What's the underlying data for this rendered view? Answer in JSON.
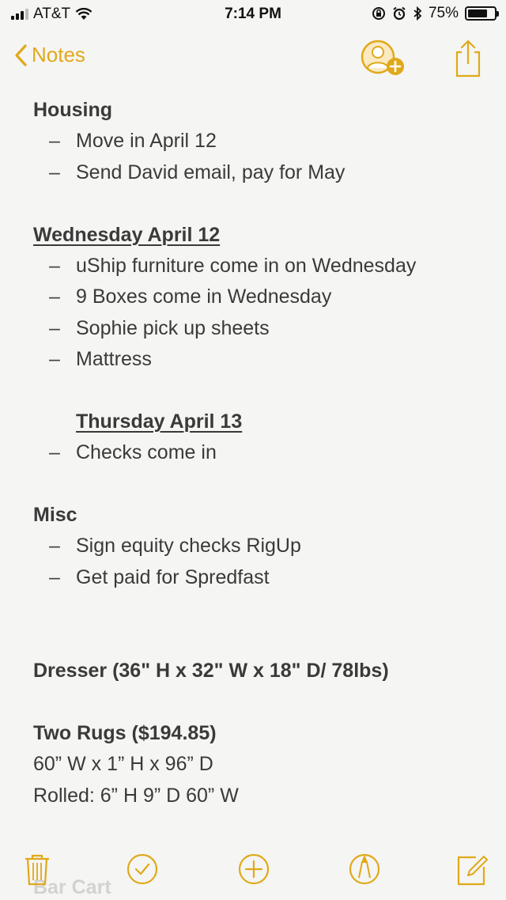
{
  "status_bar": {
    "carrier": "AT&T",
    "time": "7:14 PM",
    "battery_percent_label": "75%",
    "battery_level": 0.75
  },
  "nav": {
    "back_label": "Notes",
    "add_people_icon": "add-person-icon",
    "share_icon": "share-icon"
  },
  "note": {
    "lines": [
      {
        "type": "heading",
        "text": "Housing"
      },
      {
        "type": "bullet",
        "text": "Move in April 12"
      },
      {
        "type": "bullet",
        "text": "Send David email, pay for May"
      },
      {
        "type": "blank",
        "text": ""
      },
      {
        "type": "heading-underline",
        "text": "Wednesday April 12"
      },
      {
        "type": "bullet",
        "text": "uShip furniture come in on Wednesday"
      },
      {
        "type": "bullet",
        "text": "9 Boxes come in Wednesday"
      },
      {
        "type": "bullet",
        "text": "Sophie pick up sheets"
      },
      {
        "type": "bullet",
        "text": "Mattress"
      },
      {
        "type": "blank",
        "text": ""
      },
      {
        "type": "subheading-underline",
        "text": "Thursday April 13"
      },
      {
        "type": "bullet",
        "text": "Checks come in"
      },
      {
        "type": "blank",
        "text": ""
      },
      {
        "type": "heading",
        "text": "Misc"
      },
      {
        "type": "bullet",
        "text": "Sign equity checks RigUp"
      },
      {
        "type": "bullet",
        "text": "Get paid for Spredfast"
      },
      {
        "type": "blank",
        "text": ""
      },
      {
        "type": "blank",
        "text": ""
      },
      {
        "type": "heading",
        "text": "Dresser (36\" H x 32\" W x 18\" D/ 78lbs)"
      },
      {
        "type": "blank",
        "text": ""
      },
      {
        "type": "heading",
        "text": "Two Rugs ($194.85)"
      },
      {
        "type": "plain",
        "text": "60” W  x 1” H x 96” D"
      },
      {
        "type": "plain",
        "text": "Rolled: 6” H 9” D 60” W"
      }
    ],
    "peek_text": "Bar Cart"
  },
  "toolbar": {
    "items": [
      "trash-icon",
      "checklist-icon",
      "add-icon",
      "sketch-icon",
      "compose-icon"
    ]
  },
  "colors": {
    "accent": "#e0a91a",
    "text": "#3a3a3a",
    "background": "#f5f5f3"
  }
}
